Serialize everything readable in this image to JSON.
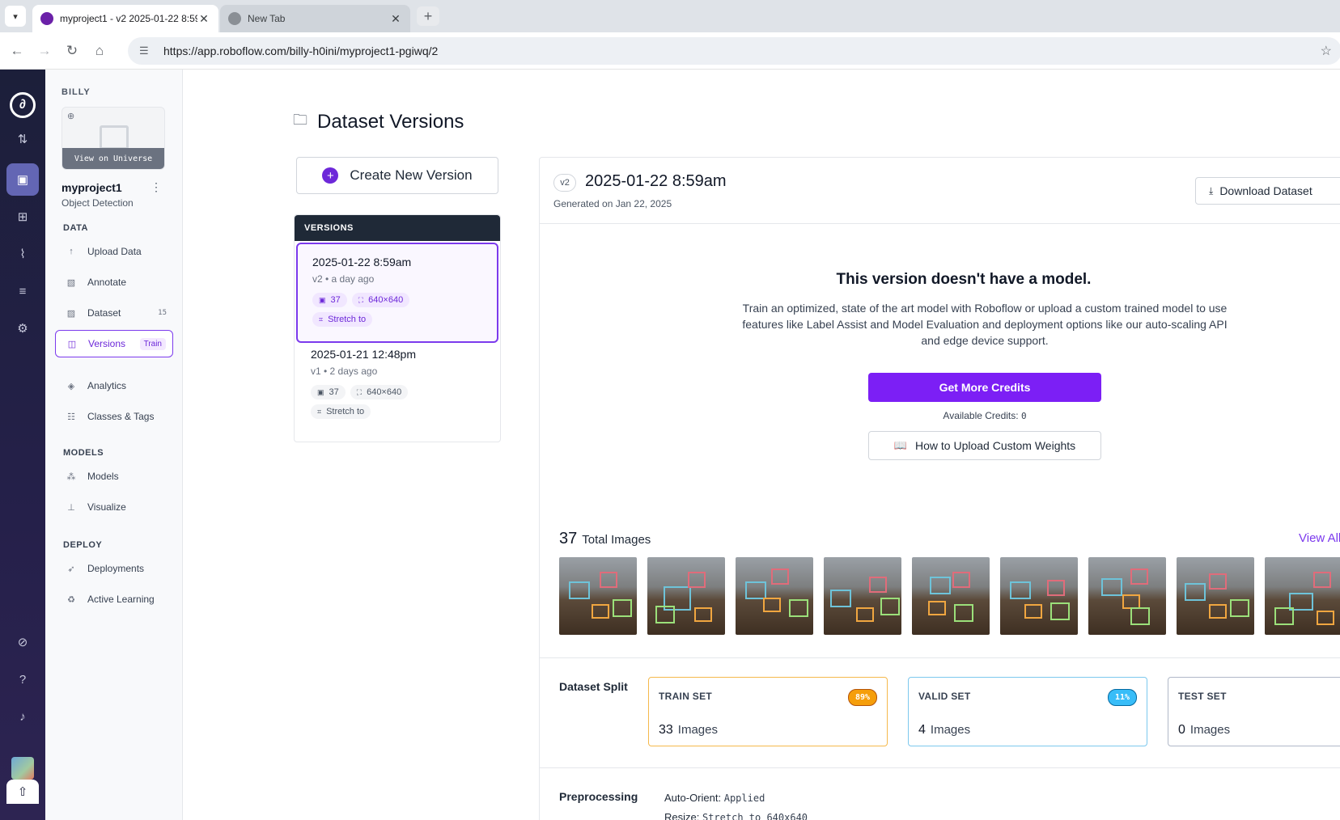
{
  "browser": {
    "tabs": [
      {
        "title": "myproject1 - v2 2025-01-22 8:59am",
        "active": true
      },
      {
        "title": "New Tab",
        "active": false
      }
    ],
    "url": "https://app.roboflow.com/billy-h0ini/myproject1-pgiwq/2"
  },
  "sidebar": {
    "workspace": "BILLY",
    "view_universe": "View on Universe",
    "project_name": "myproject1",
    "project_type": "Object Detection",
    "sections": {
      "data": "DATA",
      "models": "MODELS",
      "deploy": "DEPLOY"
    },
    "items": {
      "upload": "Upload Data",
      "annotate": "Annotate",
      "dataset": "Dataset",
      "dataset_count": "15",
      "versions": "Versions",
      "versions_badge": "Train",
      "analytics": "Analytics",
      "classes": "Classes & Tags",
      "models": "Models",
      "visualize": "Visualize",
      "deployments": "Deployments",
      "active_learning": "Active Learning"
    }
  },
  "main": {
    "title": "Dataset Versions",
    "create_button": "Create New Version",
    "versions_header": "VERSIONS",
    "versions": [
      {
        "title": "2025-01-22 8:59am",
        "sub": "v2 • a day ago",
        "images": "37",
        "size": "640×640",
        "preprocess": "Stretch to"
      },
      {
        "title": "2025-01-21 12:48pm",
        "sub": "v1 • 2 days ago",
        "images": "37",
        "size": "640×640",
        "preprocess": "Stretch to"
      }
    ]
  },
  "detail": {
    "version_badge": "v2",
    "title": "2025-01-22 8:59am",
    "generated": "Generated on Jan 22, 2025",
    "download_button": "Download Dataset",
    "no_model_title": "This version doesn't have a model.",
    "no_model_text": "Train an optimized, state of the art model with Roboflow or upload a custom trained model to use features like Label Assist and Model Evaluation and deployment options like our auto-scaling API and edge device support.",
    "credits_button": "Get More Credits",
    "available_label": "Available Credits:",
    "available_value": "0",
    "weights_button": "How to Upload Custom Weights",
    "total_count": "37",
    "total_label": "Total Images",
    "view_all": "View All",
    "split_label": "Dataset Split",
    "splits": [
      {
        "name": "TRAIN SET",
        "pct": "89%",
        "count": "33",
        "unit": "Images"
      },
      {
        "name": "VALID SET",
        "pct": "11%",
        "count": "4",
        "unit": "Images"
      },
      {
        "name": "TEST SET",
        "pct": "",
        "count": "0",
        "unit": "Images"
      }
    ],
    "preprocessing_label": "Preprocessing",
    "preprocessing": [
      {
        "key": "Auto-Orient:",
        "value": "Applied"
      },
      {
        "key": "Resize:",
        "value": "Stretch to 640x640"
      }
    ]
  },
  "colors": {
    "accent": "#7c3aed",
    "credits_button": "#7c1ff5",
    "train": "#f59e0b",
    "valid": "#38bdf8"
  }
}
